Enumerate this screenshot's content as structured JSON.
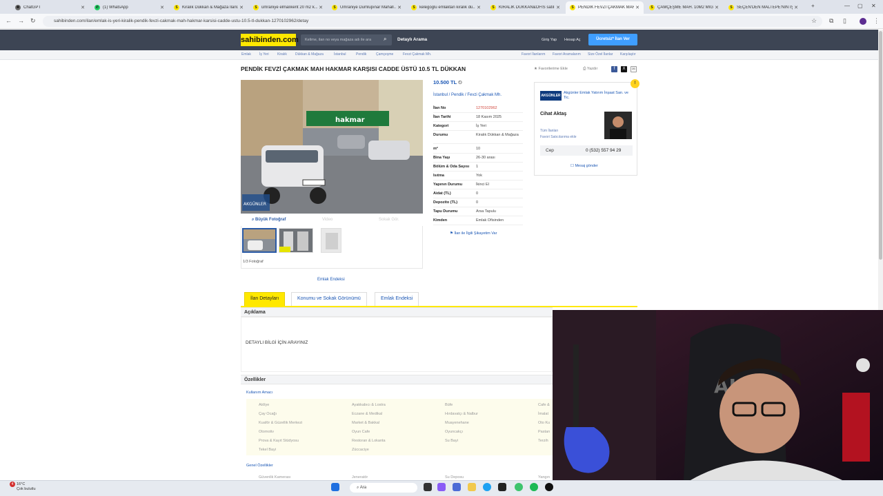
{
  "browser": {
    "tabs": [
      {
        "title": "ChatGPT",
        "color": "#6b6b6b",
        "glyph": "✺"
      },
      {
        "title": "(1) WhatsApp",
        "color": "#25d366",
        "glyph": "✆"
      },
      {
        "title": "Kiralık Dükkan & Mağaza İlanl...",
        "color": "#ffe800",
        "glyph": "S"
      },
      {
        "title": "ümraniye elmalıkent 20 m2 k...",
        "color": "#ffe800",
        "glyph": "S"
      },
      {
        "title": "Ümraniye Dumlupınar Mahall...",
        "color": "#ffe800",
        "glyph": "S"
      },
      {
        "title": "kelegoglu emlaktan kiralık dü...",
        "color": "#ffe800",
        "glyph": "S"
      },
      {
        "title": "KİRALIK DÜKKAN&OFİS satılık...",
        "color": "#ffe800",
        "glyph": "S"
      },
      {
        "title": "PENDİK FEVZİ ÇAKMAK MAH...",
        "color": "#ffe800",
        "glyph": "S"
      },
      {
        "title": "ÇAMÇEŞME MAH. 10M2 MİĞA...",
        "color": "#ffe800",
        "glyph": "S"
      },
      {
        "title": "SEÇEN'DEN MALTEPE'NİN İŞ...",
        "color": "#ffe800",
        "glyph": "S"
      }
    ],
    "new_tab": "+",
    "url": "sahibinden.com/ilan/emlak-is-yeri-kiralik-pendik-fevzi-cakmak-mah-hakmar-karsisi-cadde-ustu-10.5-tl-dukkan-1270102962/detay"
  },
  "site": {
    "logo": "sahibinden.com",
    "search_placeholder": "Kelime, ilan no veya mağaza adı ile ara",
    "detailed_search": "Detaylı Arama",
    "login": "Giriş Yap",
    "register": "Hesap Aç",
    "post_ad": "Ücretsiz* İlan Ver"
  },
  "breadcrumb": [
    "Emlak",
    "İş Yeri",
    "Kiralık",
    "Dükkan & Mağaza",
    "İstanbul",
    "Pendik",
    "Çamçeşme",
    "Fevzi Çakmak Mh."
  ],
  "breadcrumb_right": [
    "Favori İlanlarım",
    "Favori Aramalarım",
    "Size Özel İlanlar",
    "Karşılaştır"
  ],
  "listing": {
    "title": "PENDİK FEVZİ ÇAKMAK MAH HAKMAR KARŞISI CADDE ÜSTÜ 10.5 TL DÜKKAN",
    "add_favorite": "Favorilerime Ekle",
    "print": "Yazdır",
    "price": "10.500 TL",
    "location": "İstanbul  /  Pendik  /  Fevzi Çakmak Mh.",
    "big_photo": "Büyük Fotoğraf",
    "video": "Video",
    "street": "Sokak Gör.",
    "photo_count": "1/3 Fotoğraf",
    "shop_sign": "hakmar",
    "watermark": "AKGÜNLER",
    "details": [
      {
        "k": "İlan No",
        "v": "1270102962",
        "red": true
      },
      {
        "k": "İlan Tarihi",
        "v": "18 Kasım 2025"
      },
      {
        "k": "Kategori",
        "v": "İş Yeri"
      },
      {
        "k": "Durumu",
        "v": "Kiralık Dükkan & Mağaza"
      },
      {
        "k": "m²",
        "v": "10"
      },
      {
        "k": "Bina Yaşı",
        "v": "26-30 arası"
      },
      {
        "k": "Bölüm & Oda Sayısı",
        "v": "1"
      },
      {
        "k": "Isıtma",
        "v": "Yok"
      },
      {
        "k": "Yapının Durumu",
        "v": "İkinci El"
      },
      {
        "k": "Aidat (TL)",
        "v": "0"
      },
      {
        "k": "Depozito (TL)",
        "v": "0"
      },
      {
        "k": "Tapu Durumu",
        "v": "Arsa Tapulu"
      },
      {
        "k": "Kimden",
        "v": "Emlak Ofisinden"
      }
    ],
    "complain": "İlan ile İlgili Şikayetim Var",
    "emlak_endeksi": "Emlak Endeksi"
  },
  "seller": {
    "logo_text": "AKGÜNLER",
    "agency": "Akgünler Emlak Yatırım İnşaat San. ve Tic.",
    "agent": "Cihat Aktaş",
    "all_ads": "Tüm İlanları",
    "fav_seller": "Favori Satıcılarıma ekle",
    "phone_label": "Cep",
    "phone": "0 (532) 557 94 29",
    "send_message": "Mesaj gönder"
  },
  "page_tabs": [
    "İlan Detayları",
    "Konumu ve Sokak Görünümü",
    "Emlak Endeksi"
  ],
  "description": {
    "heading": "Açıklama",
    "text": "DETAYLI BİLGİ İÇİN ARAYINIZ"
  },
  "features": {
    "heading": "Özellikler",
    "usage_label": "Kullanım Amacı",
    "general_label": "Genel Özellikler",
    "columns": [
      [
        "Atölye",
        "Çay Ocağı",
        "Kuaför & Güzellik Merkezi",
        "Otomotiv",
        "Prova & Kayıt Stüdyosu",
        "Tekel Bayi"
      ],
      [
        "Ayakkabıcı & Lostra",
        "Eczane & Medikal",
        "Market & Bakkal",
        "Oyun Cafe",
        "Restoran & Lokanta",
        "Züccaciye"
      ],
      [
        "Büfe",
        "Hırdavatçı & Nalbur",
        "Muayenehane",
        "Oyuncakçı",
        "Su Bayi"
      ],
      [
        "Cafe &",
        "İmalat",
        "Oto Ku",
        "Pastan",
        "Terzih"
      ]
    ],
    "general_items": [
      "Güvenlik Kamerası",
      "Jeneratör",
      "Su Deposu",
      "Yangın"
    ]
  },
  "taskbar": {
    "temp": "16°C",
    "weather": "Çok bulutlu",
    "notif_count": "4",
    "search": "Ara"
  }
}
